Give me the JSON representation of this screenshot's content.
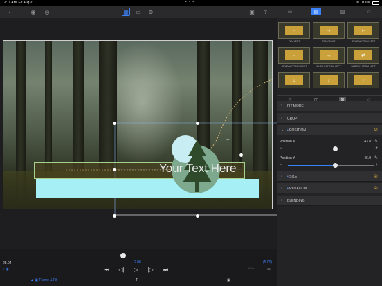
{
  "status": {
    "time": "12:11 AM",
    "date": "Fri Aug 2",
    "battery": "100%"
  },
  "toolbar": {
    "icons": [
      "back-icon",
      "eye-layers-icon",
      "eye-icon",
      "frame-icon",
      "image-icon",
      "zoom-icon",
      "camera-icon",
      "export-icon"
    ]
  },
  "canvas": {
    "title_text": "Your Text Here"
  },
  "timeline": {
    "current_time": "25.04",
    "mid_time": "2.08",
    "duration": "(5.00)",
    "frame_fit_label": "Frame & Fit"
  },
  "panel": {
    "tabs": [
      "video-icon",
      "title-icon",
      "image-icon",
      "star-icon"
    ],
    "transitions": [
      {
        "label": "PAN LEFT",
        "arrow": "←"
      },
      {
        "label": "PAN RIGHT",
        "arrow": "→"
      },
      {
        "label": "REVEAL FROM LEFT",
        "arrow": "←"
      },
      {
        "label": "REVEAL FROM RIGHT",
        "arrow": "→"
      },
      {
        "label": "SLIDE IN FROM LEFT",
        "arrow": "→"
      },
      {
        "label": "SLIDE IN FROM LEFT",
        "arrow": "⇄"
      },
      {
        "label": "",
        "arrow": "↓"
      },
      {
        "label": "",
        "arrow": "↓"
      },
      {
        "label": "",
        "arrow": "↑"
      }
    ],
    "sections": {
      "fit_mode": "FIT MODE",
      "crop": "CROP",
      "position": "POSITION",
      "size": "SIZE",
      "rotation": "ROTATION",
      "blending": "BLENDING"
    },
    "position_x": {
      "label": "Position X",
      "value": "43.8",
      "fraction": 0.55
    },
    "position_y": {
      "label": "Position Y",
      "value": "46.9",
      "fraction": 0.55
    }
  },
  "colors": {
    "accent": "#3b82f6",
    "keyframe": "#c9a03a",
    "title_bar": "#a6f0f5"
  }
}
